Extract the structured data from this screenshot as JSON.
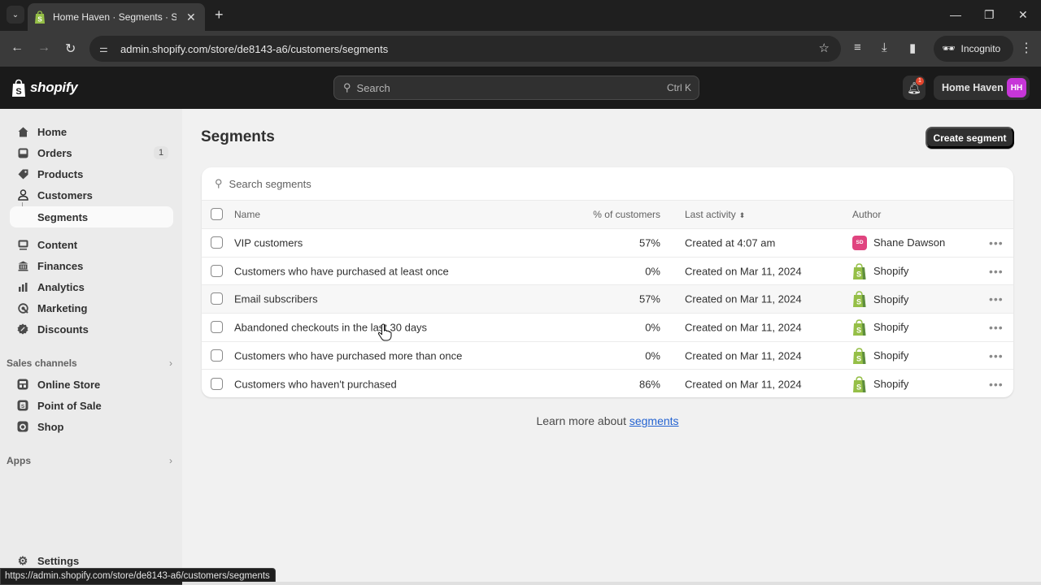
{
  "browser": {
    "tab_title": "Home Haven · Segments · Shopify",
    "url": "admin.shopify.com/store/de8143-a6/customers/segments",
    "incognito_label": "Incognito",
    "status_url": "https://admin.shopify.com/store/de8143-a6/customers/segments"
  },
  "topbar": {
    "logo_text": "shopify",
    "search_placeholder": "Search",
    "search_shortcut": "Ctrl K",
    "notification_count": "1",
    "store_name": "Home Haven",
    "store_initials": "HH"
  },
  "sidebar": {
    "items": [
      {
        "label": "Home",
        "icon": "home-icon"
      },
      {
        "label": "Orders",
        "icon": "inbox-icon",
        "badge": "1"
      },
      {
        "label": "Products",
        "icon": "tag-icon"
      },
      {
        "label": "Customers",
        "icon": "person-icon"
      },
      {
        "label": "Segments",
        "icon": "sub-item",
        "active": true
      },
      {
        "label": "Content",
        "icon": "image-icon"
      },
      {
        "label": "Finances",
        "icon": "bank-icon"
      },
      {
        "label": "Analytics",
        "icon": "bar-chart-icon"
      },
      {
        "label": "Marketing",
        "icon": "target-icon"
      },
      {
        "label": "Discounts",
        "icon": "discount-icon"
      }
    ],
    "sales_channels_label": "Sales channels",
    "sales_channels": [
      {
        "label": "Online Store",
        "icon": "store-icon"
      },
      {
        "label": "Point of Sale",
        "icon": "pos-icon"
      },
      {
        "label": "Shop",
        "icon": "shop-icon"
      }
    ],
    "apps_label": "Apps",
    "settings_label": "Settings"
  },
  "main": {
    "title": "Segments",
    "create_button": "Create segment",
    "search_placeholder": "Search segments",
    "columns": {
      "name": "Name",
      "percent": "% of customers",
      "last_activity": "Last activity",
      "author": "Author"
    },
    "rows": [
      {
        "name": "VIP customers",
        "percent": "57%",
        "last_activity": "Created at 4:07 am",
        "author": "Shane Dawson",
        "author_initials": "SD",
        "author_type": "user"
      },
      {
        "name": "Customers who have purchased at least once",
        "percent": "0%",
        "last_activity": "Created on Mar 11, 2024",
        "author": "Shopify",
        "author_type": "shopify"
      },
      {
        "name": "Email subscribers",
        "percent": "57%",
        "last_activity": "Created on Mar 11, 2024",
        "author": "Shopify",
        "author_type": "shopify"
      },
      {
        "name": "Abandoned checkouts in the last 30 days",
        "percent": "0%",
        "last_activity": "Created on Mar 11, 2024",
        "author": "Shopify",
        "author_type": "shopify"
      },
      {
        "name": "Customers who have purchased more than once",
        "percent": "0%",
        "last_activity": "Created on Mar 11, 2024",
        "author": "Shopify",
        "author_type": "shopify"
      },
      {
        "name": "Customers who haven't purchased",
        "percent": "86%",
        "last_activity": "Created on Mar 11, 2024",
        "author": "Shopify",
        "author_type": "shopify"
      }
    ],
    "more_actions": "•••",
    "learn_prefix": "Learn more about ",
    "learn_link": "segments"
  },
  "colors": {
    "accent_dark": "#303030",
    "store_avatar": "#c736d8",
    "author_avatar": "#e0447f",
    "shopify_green": "#95bf47",
    "link": "#2463d1",
    "notification": "#e5462e"
  }
}
